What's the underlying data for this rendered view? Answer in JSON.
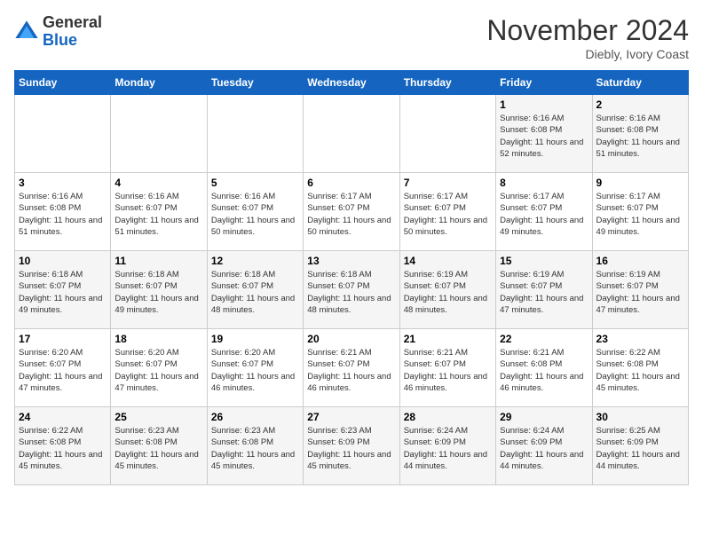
{
  "header": {
    "logo": {
      "general": "General",
      "blue": "Blue"
    },
    "title": "November 2024",
    "subtitle": "Diebly, Ivory Coast"
  },
  "calendar": {
    "days_of_week": [
      "Sunday",
      "Monday",
      "Tuesday",
      "Wednesday",
      "Thursday",
      "Friday",
      "Saturday"
    ],
    "weeks": [
      [
        {
          "day": "",
          "info": ""
        },
        {
          "day": "",
          "info": ""
        },
        {
          "day": "",
          "info": ""
        },
        {
          "day": "",
          "info": ""
        },
        {
          "day": "",
          "info": ""
        },
        {
          "day": "1",
          "info": "Sunrise: 6:16 AM\nSunset: 6:08 PM\nDaylight: 11 hours and 52 minutes."
        },
        {
          "day": "2",
          "info": "Sunrise: 6:16 AM\nSunset: 6:08 PM\nDaylight: 11 hours and 51 minutes."
        }
      ],
      [
        {
          "day": "3",
          "info": "Sunrise: 6:16 AM\nSunset: 6:08 PM\nDaylight: 11 hours and 51 minutes."
        },
        {
          "day": "4",
          "info": "Sunrise: 6:16 AM\nSunset: 6:07 PM\nDaylight: 11 hours and 51 minutes."
        },
        {
          "day": "5",
          "info": "Sunrise: 6:16 AM\nSunset: 6:07 PM\nDaylight: 11 hours and 50 minutes."
        },
        {
          "day": "6",
          "info": "Sunrise: 6:17 AM\nSunset: 6:07 PM\nDaylight: 11 hours and 50 minutes."
        },
        {
          "day": "7",
          "info": "Sunrise: 6:17 AM\nSunset: 6:07 PM\nDaylight: 11 hours and 50 minutes."
        },
        {
          "day": "8",
          "info": "Sunrise: 6:17 AM\nSunset: 6:07 PM\nDaylight: 11 hours and 49 minutes."
        },
        {
          "day": "9",
          "info": "Sunrise: 6:17 AM\nSunset: 6:07 PM\nDaylight: 11 hours and 49 minutes."
        }
      ],
      [
        {
          "day": "10",
          "info": "Sunrise: 6:18 AM\nSunset: 6:07 PM\nDaylight: 11 hours and 49 minutes."
        },
        {
          "day": "11",
          "info": "Sunrise: 6:18 AM\nSunset: 6:07 PM\nDaylight: 11 hours and 49 minutes."
        },
        {
          "day": "12",
          "info": "Sunrise: 6:18 AM\nSunset: 6:07 PM\nDaylight: 11 hours and 48 minutes."
        },
        {
          "day": "13",
          "info": "Sunrise: 6:18 AM\nSunset: 6:07 PM\nDaylight: 11 hours and 48 minutes."
        },
        {
          "day": "14",
          "info": "Sunrise: 6:19 AM\nSunset: 6:07 PM\nDaylight: 11 hours and 48 minutes."
        },
        {
          "day": "15",
          "info": "Sunrise: 6:19 AM\nSunset: 6:07 PM\nDaylight: 11 hours and 47 minutes."
        },
        {
          "day": "16",
          "info": "Sunrise: 6:19 AM\nSunset: 6:07 PM\nDaylight: 11 hours and 47 minutes."
        }
      ],
      [
        {
          "day": "17",
          "info": "Sunrise: 6:20 AM\nSunset: 6:07 PM\nDaylight: 11 hours and 47 minutes."
        },
        {
          "day": "18",
          "info": "Sunrise: 6:20 AM\nSunset: 6:07 PM\nDaylight: 11 hours and 47 minutes."
        },
        {
          "day": "19",
          "info": "Sunrise: 6:20 AM\nSunset: 6:07 PM\nDaylight: 11 hours and 46 minutes."
        },
        {
          "day": "20",
          "info": "Sunrise: 6:21 AM\nSunset: 6:07 PM\nDaylight: 11 hours and 46 minutes."
        },
        {
          "day": "21",
          "info": "Sunrise: 6:21 AM\nSunset: 6:07 PM\nDaylight: 11 hours and 46 minutes."
        },
        {
          "day": "22",
          "info": "Sunrise: 6:21 AM\nSunset: 6:08 PM\nDaylight: 11 hours and 46 minutes."
        },
        {
          "day": "23",
          "info": "Sunrise: 6:22 AM\nSunset: 6:08 PM\nDaylight: 11 hours and 45 minutes."
        }
      ],
      [
        {
          "day": "24",
          "info": "Sunrise: 6:22 AM\nSunset: 6:08 PM\nDaylight: 11 hours and 45 minutes."
        },
        {
          "day": "25",
          "info": "Sunrise: 6:23 AM\nSunset: 6:08 PM\nDaylight: 11 hours and 45 minutes."
        },
        {
          "day": "26",
          "info": "Sunrise: 6:23 AM\nSunset: 6:08 PM\nDaylight: 11 hours and 45 minutes."
        },
        {
          "day": "27",
          "info": "Sunrise: 6:23 AM\nSunset: 6:09 PM\nDaylight: 11 hours and 45 minutes."
        },
        {
          "day": "28",
          "info": "Sunrise: 6:24 AM\nSunset: 6:09 PM\nDaylight: 11 hours and 44 minutes."
        },
        {
          "day": "29",
          "info": "Sunrise: 6:24 AM\nSunset: 6:09 PM\nDaylight: 11 hours and 44 minutes."
        },
        {
          "day": "30",
          "info": "Sunrise: 6:25 AM\nSunset: 6:09 PM\nDaylight: 11 hours and 44 minutes."
        }
      ]
    ]
  }
}
